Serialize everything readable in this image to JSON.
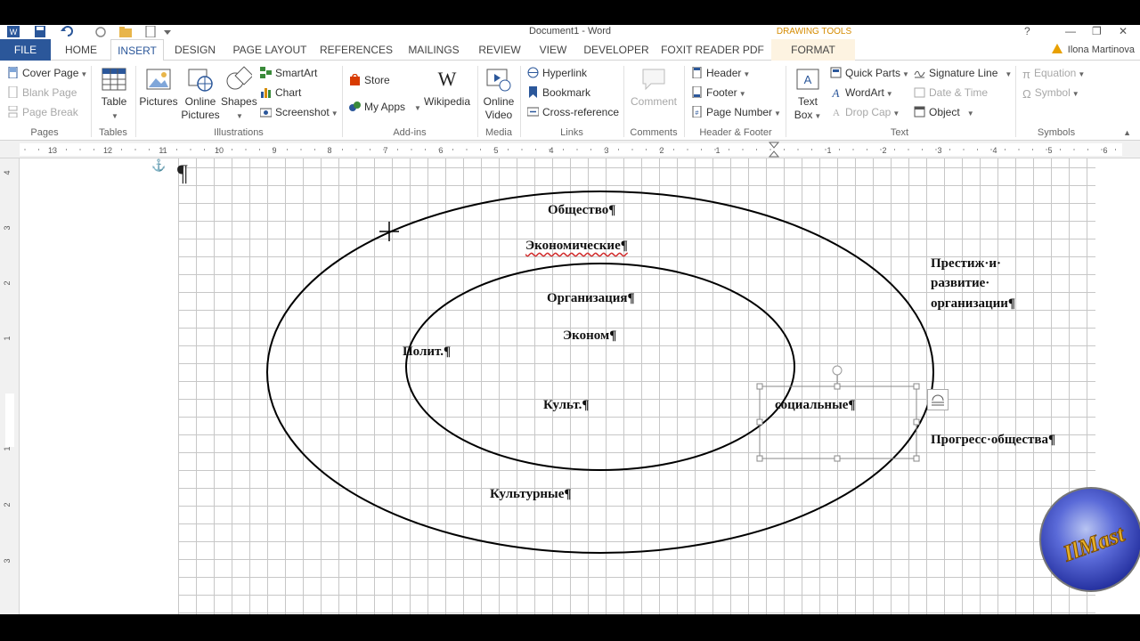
{
  "window": {
    "document_title": "Document1 - Word",
    "contextual_group": "DRAWING TOOLS",
    "help_label": "?",
    "minimize_label": "—",
    "restore_label": "❐",
    "close_label": "✕"
  },
  "tabs": {
    "file": "FILE",
    "home": "HOME",
    "insert": "INSERT",
    "design": "DESIGN",
    "page_layout": "PAGE LAYOUT",
    "references": "REFERENCES",
    "mailings": "MAILINGS",
    "review": "REVIEW",
    "view": "VIEW",
    "developer": "DEVELOPER",
    "foxit": "FOXIT READER PDF",
    "format": "FORMAT",
    "active": "INSERT"
  },
  "user": {
    "name": "Ilona Martinova"
  },
  "ribbon": {
    "pages": {
      "cover_page": "Cover Page",
      "blank_page": "Blank Page",
      "page_break": "Page Break",
      "group": "Pages"
    },
    "tables": {
      "table": "Table",
      "group": "Tables"
    },
    "illustrations": {
      "pictures": "Pictures",
      "online_pictures_1": "Online",
      "online_pictures_2": "Pictures",
      "shapes": "Shapes",
      "smartart": "SmartArt",
      "chart": "Chart",
      "screenshot": "Screenshot",
      "group": "Illustrations"
    },
    "addins": {
      "store": "Store",
      "my_apps": "My Apps",
      "wikipedia": "Wikipedia",
      "group": "Add-ins"
    },
    "media": {
      "online_video_1": "Online",
      "online_video_2": "Video",
      "group": "Media"
    },
    "links": {
      "hyperlink": "Hyperlink",
      "bookmark": "Bookmark",
      "cross_reference": "Cross-reference",
      "group": "Links"
    },
    "comments": {
      "comment": "Comment",
      "group": "Comments"
    },
    "header_footer": {
      "header": "Header",
      "footer": "Footer",
      "page_number": "Page Number",
      "group": "Header & Footer"
    },
    "text": {
      "text_box_1": "Text",
      "text_box_2": "Box",
      "quick_parts": "Quick Parts",
      "wordart": "WordArt",
      "drop_cap": "Drop Cap",
      "signature_line": "Signature Line",
      "date_time": "Date & Time",
      "object": "Object",
      "group": "Text"
    },
    "symbols": {
      "equation": "Equation",
      "symbol": "Symbol",
      "group": "Symbols"
    }
  },
  "ruler": {
    "h_ticks": [
      "13",
      "12",
      "11",
      "10",
      "9",
      "8",
      "7",
      "6",
      "5",
      "4",
      "3",
      "2",
      "1",
      "1",
      "2",
      "3",
      "4",
      "5",
      "6"
    ],
    "v_ticks": [
      "4",
      "3",
      "2",
      "1",
      "1",
      "2",
      "3"
    ]
  },
  "document": {
    "paragraph_mark": "¶",
    "anchor_glyph": "⚓",
    "labels": {
      "society": "Общество¶",
      "economic": "Экономические¶",
      "organization": "Организация¶",
      "econom": "Эконом¶",
      "polit": "Полит.¶",
      "kult": "Культ.¶",
      "social": "социальные¶",
      "cultural": "Культурные¶",
      "prestige_1": "Престиж·и·",
      "prestige_2": "развитие·",
      "prestige_3": "организации¶",
      "progress": "Прогресс·общества¶"
    }
  },
  "logo": {
    "text": "IlMast"
  },
  "colors": {
    "accent": "#2b579a",
    "drawing_tools": "#d58b00",
    "grid": "#c7c7c7"
  }
}
